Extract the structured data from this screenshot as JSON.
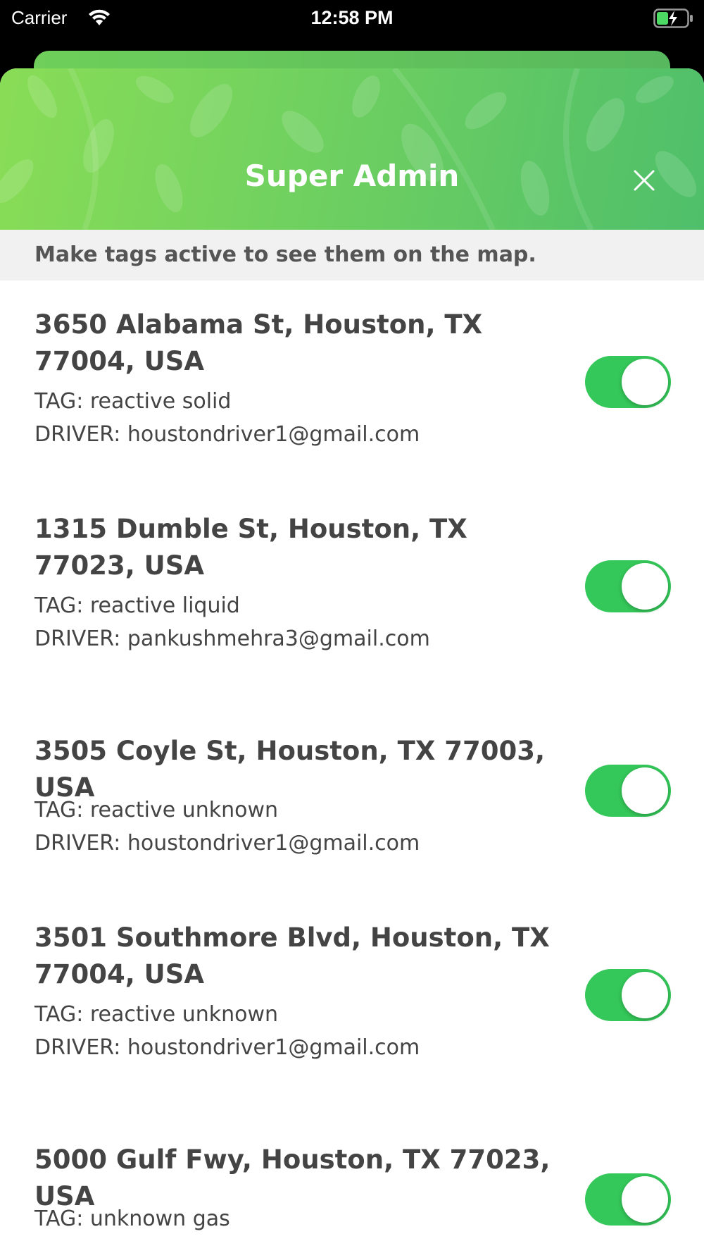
{
  "status_bar": {
    "carrier": "Carrier",
    "time": "12:58 PM"
  },
  "header": {
    "title": "Super Admin",
    "close_icon": "close-icon",
    "gradient_colors": [
      "#89dd56",
      "#4fbf6a"
    ]
  },
  "subheader": {
    "text": "Make tags active to see them on the map."
  },
  "toggle_color": "#34c759",
  "items": [
    {
      "address_line1": "3650 Alabama St, Houston, TX",
      "address_line2": "77004, USA",
      "tag": "TAG: reactive solid",
      "driver": "DRIVER: houstondriver1@gmail.com",
      "active": true
    },
    {
      "address_line1": "1315 Dumble St, Houston, TX",
      "address_line2": "77023, USA",
      "tag": "TAG: reactive liquid",
      "driver": "DRIVER: pankushmehra3@gmail.com",
      "active": true
    },
    {
      "address_line1": "3505 Coyle St, Houston, TX 77003, USA",
      "address_line2": "",
      "tag": "TAG: reactive unknown",
      "driver": "DRIVER: houstondriver1@gmail.com",
      "active": true
    },
    {
      "address_line1": "3501 Southmore Blvd, Houston, TX",
      "address_line2": "77004, USA",
      "tag": "TAG: reactive unknown",
      "driver": "DRIVER: houstondriver1@gmail.com",
      "active": true
    },
    {
      "address_line1": "5000 Gulf Fwy, Houston, TX 77023, USA",
      "address_line2": "",
      "tag": "TAG: unknown gas",
      "driver": "",
      "active": true
    }
  ]
}
